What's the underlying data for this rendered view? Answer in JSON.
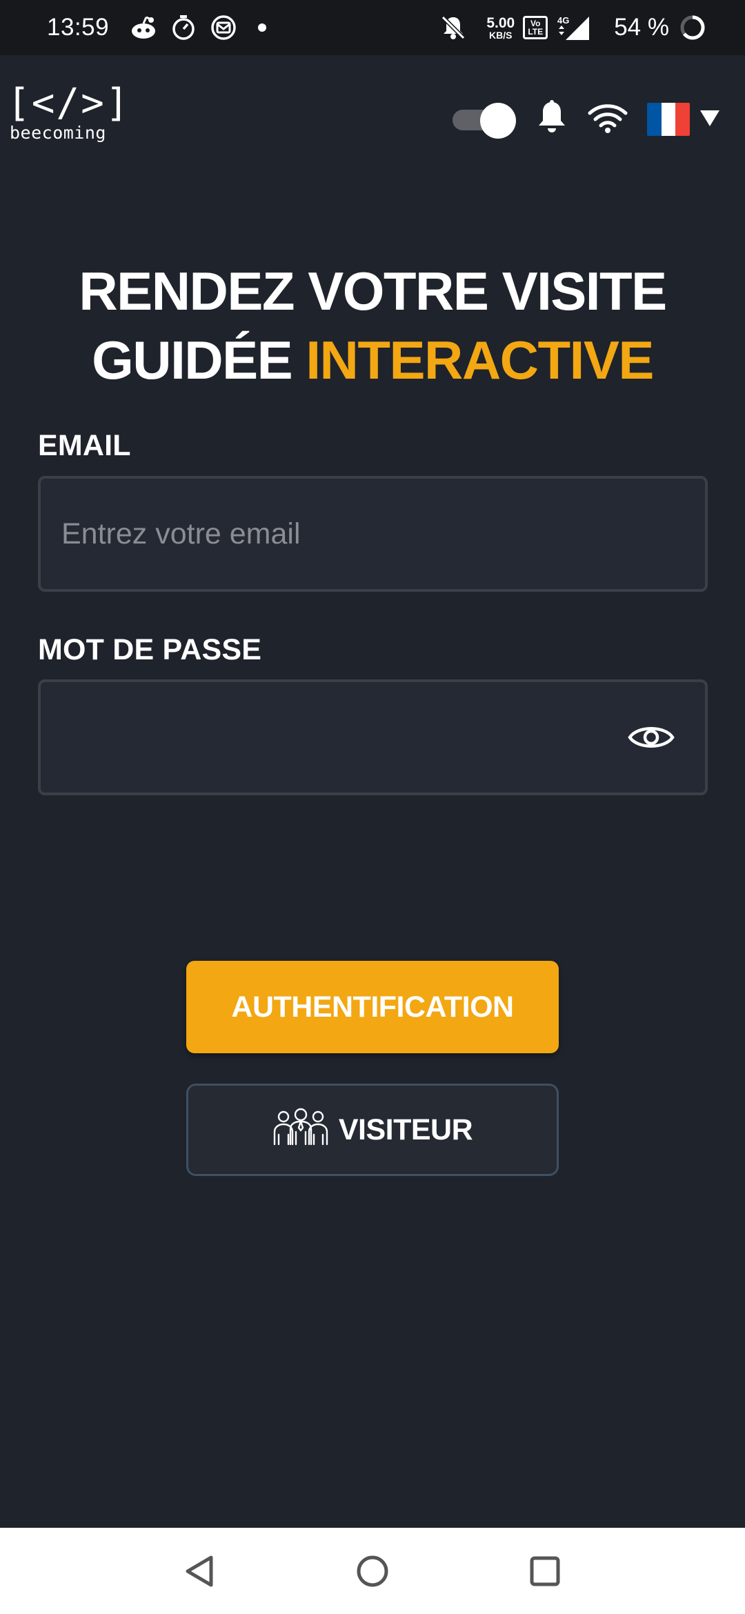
{
  "status_bar": {
    "time": "13:59",
    "net_speed_value": "5.00",
    "net_speed_unit": "KB/S",
    "volte_label": "Vo\nLTE",
    "network_type": "4G",
    "battery_percent": "54 %",
    "icons": [
      "reddit-icon",
      "timer-icon",
      "mail-icon",
      "notification-dot",
      "bell-off-icon",
      "signal-icon",
      "battery-ring-icon"
    ]
  },
  "header": {
    "logo_mark": "[</>]",
    "logo_text": "beecoming",
    "dark_mode_toggle_on": true,
    "language": "fr",
    "flag_colors": [
      "#0055a4",
      "#ffffff",
      "#ef4135"
    ]
  },
  "hero": {
    "line1": "RENDEZ VOTRE VISITE",
    "line2_plain": "GUIDÉE ",
    "line2_accent": "INTERACTIVE"
  },
  "form": {
    "email_label": "EMAIL",
    "email_placeholder": "Entrez votre email",
    "email_value": "",
    "password_label": "MOT DE PASSE",
    "password_value": ""
  },
  "buttons": {
    "auth_label": "AUTHENTIFICATION",
    "visitor_label": "VISITEUR"
  },
  "colors": {
    "background": "#1f232b",
    "accent": "#f2a713",
    "field_bg": "#252933",
    "field_border": "#3b3f46"
  }
}
